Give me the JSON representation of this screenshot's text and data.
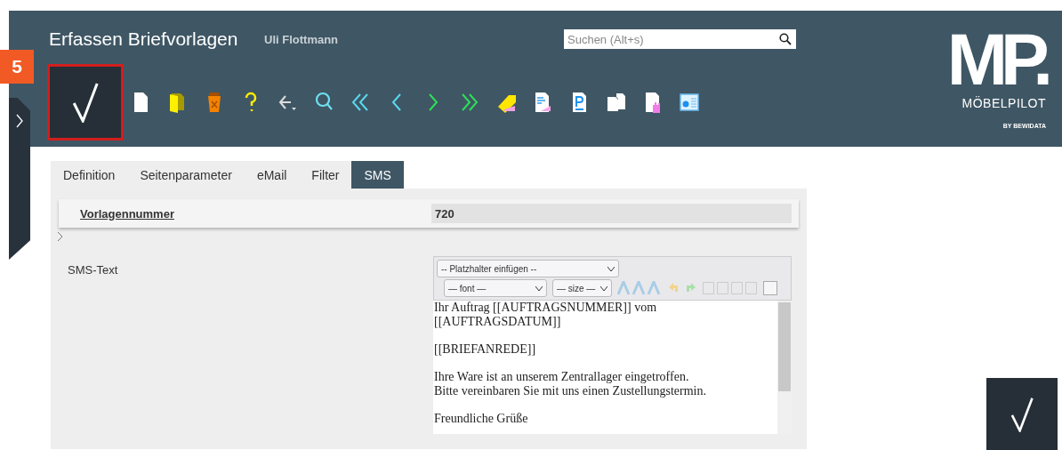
{
  "header": {
    "title": "Erfassen Briefvorlagen",
    "user": "Uli Flottmann",
    "search": {
      "placeholder": "Suchen (Alt+s)"
    },
    "step_badge": "5",
    "logo": {
      "mark": "MP",
      "dot": ".",
      "name": "MÖBELPILOT",
      "tagline": "BY BEWIDATA"
    }
  },
  "toolbar": [
    {
      "kind": "new"
    },
    {
      "kind": "open"
    },
    {
      "kind": "delete"
    },
    {
      "kind": "help"
    },
    {
      "kind": "back"
    },
    {
      "kind": "search"
    },
    {
      "kind": "first"
    },
    {
      "kind": "prev"
    },
    {
      "kind": "next"
    },
    {
      "kind": "last"
    },
    {
      "kind": "tag"
    },
    {
      "kind": "edit"
    },
    {
      "kind": "pdf"
    },
    {
      "kind": "copy"
    },
    {
      "kind": "hand"
    },
    {
      "kind": "text"
    }
  ],
  "tabs": [
    {
      "label": "Definition",
      "selected": false
    },
    {
      "label": "Seitenparameter",
      "selected": false
    },
    {
      "label": "eMail",
      "selected": false
    },
    {
      "label": "Filter",
      "selected": false
    },
    {
      "label": "SMS",
      "selected": true
    }
  ],
  "form": {
    "number_label": "Vorlagennummer",
    "number_value": "720",
    "sms_label": "SMS-Text",
    "editor": {
      "placeholder_select": "-- Platzhalter einfügen --",
      "font_select": "— font —",
      "size_select": "— size —",
      "paragraphs": [
        [
          "Ihr Auftrag [[AUFTRAGSNUMMER]] vom",
          "[[AUFTRAGSDATUM]]"
        ],
        [
          "[[BRIEFANREDE]]"
        ],
        [
          "Ihre Ware ist an unserem Zentrallager eingetroffen.",
          "Bitte vereinbaren Sie mit uns einen Zustellungstermin."
        ],
        [
          "Freundliche Grüße"
        ]
      ]
    }
  }
}
